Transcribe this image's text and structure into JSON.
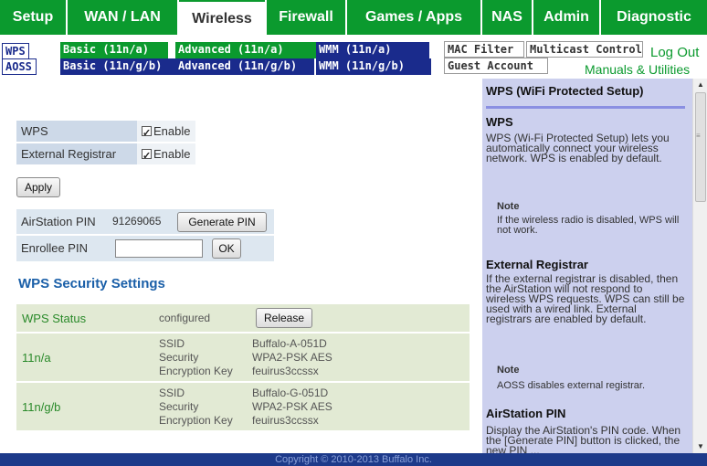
{
  "nav": {
    "tabs": [
      {
        "label": "Setup"
      },
      {
        "label": "WAN / LAN"
      },
      {
        "label": "Wireless"
      },
      {
        "label": "Firewall"
      },
      {
        "label": "Games / Apps"
      },
      {
        "label": "NAS"
      },
      {
        "label": "Admin"
      },
      {
        "label": "Diagnostic"
      }
    ],
    "active_tab": "Wireless",
    "accent_color": "#0b9a2e"
  },
  "subnav": {
    "wps": "WPS",
    "aoss": "AOSS",
    "basic_n_a": "Basic (11n/a)",
    "basic_n_g_b": "Basic (11n/g/b)",
    "advanced_n_a": "Advanced (11n/a)",
    "advanced_n_g_b": "Advanced (11n/g/b)",
    "wmm_n_a": "WMM (11n/a)",
    "wmm_n_g_b": "WMM (11n/g/b)",
    "mac_filter": "MAC Filter",
    "multicast_control": "Multicast Control",
    "guest_account": "Guest Account",
    "logout": "Log Out",
    "manuals": "Manuals & Utilities"
  },
  "form": {
    "wps_label": "WPS",
    "wps_enable": "Enable",
    "ext_reg_label": "External Registrar",
    "ext_reg_enable": "Enable",
    "apply_button": "Apply",
    "airstation_pin_label": "AirStation PIN",
    "airstation_pin_value": "91269065",
    "generate_pin_button": "Generate PIN",
    "enrollee_pin_label": "Enrollee PIN",
    "enrollee_pin_value": "",
    "ok_button": "OK"
  },
  "security": {
    "title": "WPS Security Settings",
    "status_label": "WPS Status",
    "status_value": "configured",
    "release_button": "Release",
    "bands": [
      {
        "band": "11n/a",
        "ssid_label": "SSID",
        "ssid": "Buffalo-A-051D",
        "security_label": "Security",
        "security": "WPA2-PSK AES",
        "key_label": "Encryption Key",
        "key": "feuirus3ccssx"
      },
      {
        "band": "11n/g/b",
        "ssid_label": "SSID",
        "ssid": "Buffalo-G-051D",
        "security_label": "Security",
        "security": "WPA2-PSK AES",
        "key_label": "Encryption Key",
        "key": "feuirus3ccssx"
      }
    ]
  },
  "help": {
    "title": "WPS (WiFi Protected Setup)",
    "wps_heading": "WPS",
    "wps_text": "WPS (Wi-Fi Protected Setup) lets you automatically connect your wireless network. WPS is enabled by default.",
    "note1_label": "Note",
    "note1_text": "If the wireless radio is disabled, WPS will not work.",
    "ext_heading": "External Registrar",
    "ext_text": "If the external registrar is disabled, then the AirStation will not respond to wireless WPS requests. WPS can still be used with a wired link. External registrars are enabled by default.",
    "note2_label": "Note",
    "note2_text": "AOSS disables external registrar.",
    "pin_heading": "AirStation PIN",
    "pin_text": "Display the AirStation's PIN code. When the [Generate PIN] button is clicked, the new PIN ..."
  },
  "footer": "Copyright © 2010-2013 Buffalo Inc."
}
